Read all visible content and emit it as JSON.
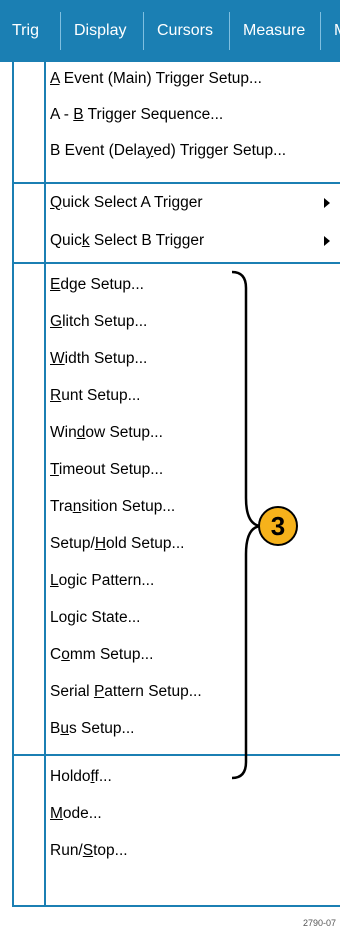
{
  "menubar": {
    "items": [
      "Trig",
      "Display",
      "Cursors",
      "Measure",
      "M"
    ]
  },
  "menu": {
    "group1": [
      {
        "label": "A Event (Main) Trigger Setup...",
        "pre": "",
        "u": "A",
        "post": " Event (Main) Trigger Setup..."
      },
      {
        "label": "A - B Trigger Sequence...",
        "pre": "A - ",
        "u": "B",
        "post": " Trigger Sequence..."
      },
      {
        "label": "B Event (Delayed) Trigger Setup...",
        "pre": "B Event (Dela",
        "u": "y",
        "post": "ed) Trigger Setup..."
      }
    ],
    "group2": [
      {
        "label": "Quick Select A Trigger",
        "pre": "",
        "u": "Q",
        "post": "uick Select A Trigger",
        "submenu": true
      },
      {
        "label": "Quick Select B Trigger",
        "pre": "Quic",
        "u": "k",
        "post": " Select B Trigger",
        "submenu": true
      }
    ],
    "group3": [
      {
        "pre": "",
        "u": "E",
        "post": "dge Setup..."
      },
      {
        "pre": "",
        "u": "G",
        "post": "litch Setup..."
      },
      {
        "pre": "",
        "u": "W",
        "post": "idth Setup..."
      },
      {
        "pre": "",
        "u": "R",
        "post": "unt Setup..."
      },
      {
        "pre": "Win",
        "u": "d",
        "post": "ow Setup..."
      },
      {
        "pre": "",
        "u": "T",
        "post": "imeout Setup..."
      },
      {
        "pre": "Tra",
        "u": "n",
        "post": "sition Setup..."
      },
      {
        "pre": "Setup/",
        "u": "H",
        "post": "old Setup..."
      },
      {
        "pre": "",
        "u": "L",
        "post": "ogic Pattern..."
      },
      {
        "pre": "Lo",
        "u": "g",
        "post": "ic State..."
      },
      {
        "pre": "C",
        "u": "o",
        "post": "mm Setup..."
      },
      {
        "pre": "Serial ",
        "u": "P",
        "post": "attern Setup..."
      },
      {
        "pre": "B",
        "u": "u",
        "post": "s Setup..."
      }
    ],
    "group4": [
      {
        "pre": "Holdo",
        "u": "f",
        "post": "f..."
      },
      {
        "pre": "",
        "u": "M",
        "post": "ode..."
      },
      {
        "pre": "Run/",
        "u": "S",
        "post": "top..."
      }
    ]
  },
  "callout": {
    "number": "3"
  },
  "footnote": "2790-07",
  "colors": {
    "menubar": "#1b7fb3",
    "callout": "#f6b21b"
  }
}
